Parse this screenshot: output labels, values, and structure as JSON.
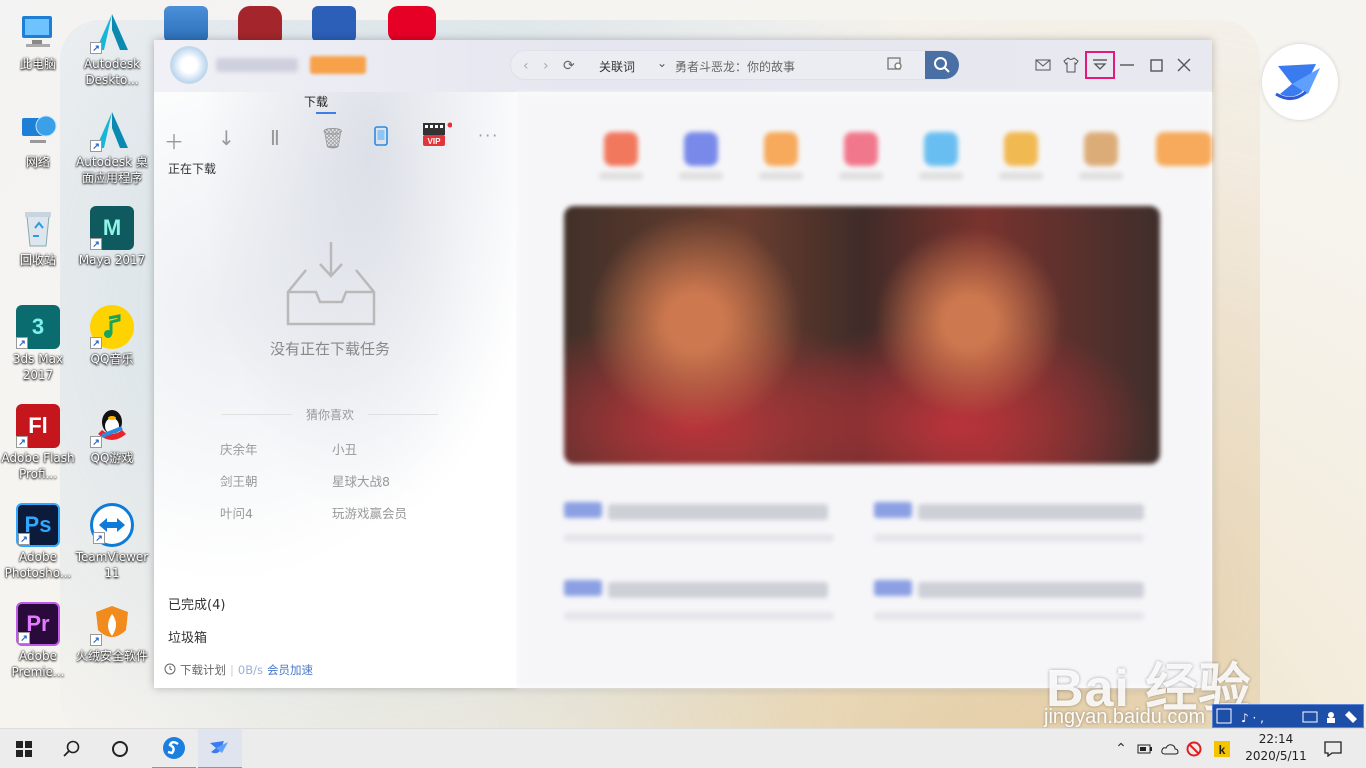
{
  "desktop": {
    "col1": [
      {
        "label": "此电脑",
        "icon": "this-pc-icon"
      },
      {
        "label": "网络",
        "icon": "network-icon"
      },
      {
        "label": "回收站",
        "icon": "recycle-bin-icon"
      },
      {
        "label": "3ds Max 2017",
        "icon": "3dsmax-icon",
        "glyph": "3"
      },
      {
        "label": "Adobe Flash Profi...",
        "icon": "flash-icon",
        "glyph": "Fl"
      },
      {
        "label": "Adobe Photosho...",
        "icon": "photoshop-icon",
        "glyph": "Ps"
      },
      {
        "label": "Adobe Premie...",
        "icon": "premiere-icon",
        "glyph": "Pr"
      }
    ],
    "col2": [
      {
        "label": "Autodesk Deskto...",
        "icon": "autodesk-desktop-icon"
      },
      {
        "label": "Autodesk 桌面应用程序",
        "icon": "autodesk-app-icon"
      },
      {
        "label": "Maya 2017",
        "icon": "maya-icon",
        "glyph": "M"
      },
      {
        "label": "QQ音乐",
        "icon": "qq-music-icon"
      },
      {
        "label": "QQ游戏",
        "icon": "qq-game-icon"
      },
      {
        "label": "TeamViewer 11",
        "icon": "teamviewer-icon"
      },
      {
        "label": "火绒安全软件",
        "icon": "huorong-icon"
      }
    ]
  },
  "window": {
    "search": {
      "keyword_label": "关联词",
      "query": "勇者斗恶龙：你的故事"
    },
    "tabs": {
      "download": "下载"
    },
    "left": {
      "section_downloading": "正在下载",
      "empty_text": "没有正在下载任务",
      "guess_title": "猜你喜欢",
      "recommendations": [
        "庆余年",
        "小丑",
        "剑王朝",
        "星球大战8",
        "叶问4",
        "玩游戏赢会员"
      ],
      "completed": "已完成(4)",
      "trash": "垃圾箱",
      "footer": {
        "plan": "下载计划",
        "speed": "0B/s",
        "accelerate": "会员加速"
      },
      "vip_label": "VIP"
    }
  },
  "taskbar": {
    "time": "22:14",
    "date": "2020/5/11"
  },
  "watermark": {
    "brand": "Bai  经验",
    "url": "jingyan.baidu.com"
  },
  "colors": {
    "accent": "#4a6fa5",
    "highlight": "#e5197a",
    "link": "#4a78c8"
  }
}
